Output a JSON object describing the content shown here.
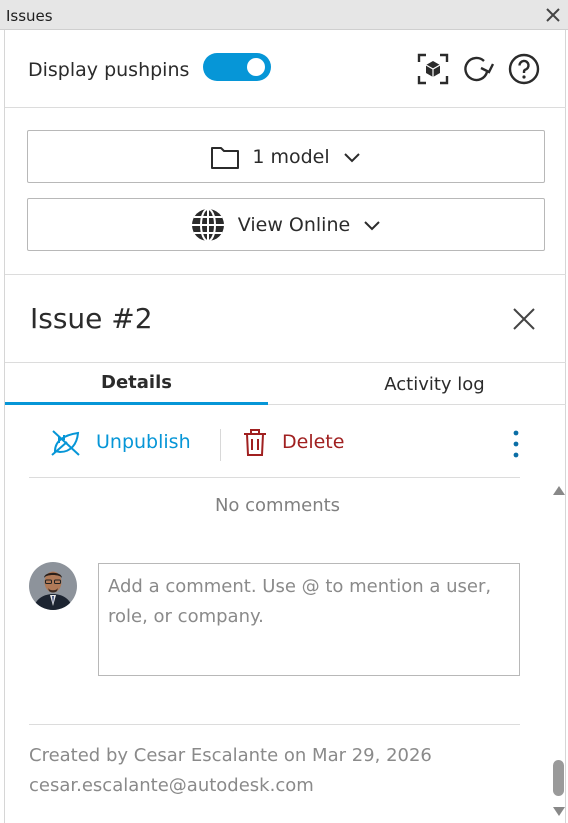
{
  "window": {
    "title": "Issues"
  },
  "toolbar": {
    "pushpins_label": "Display pushpins",
    "pushpins_on": true,
    "icons": [
      "focus-model-icon",
      "refresh-icon",
      "help-icon"
    ]
  },
  "selectors": {
    "model_label": "1 model",
    "view_label": "View Online"
  },
  "issue": {
    "title": "Issue #2"
  },
  "tabs": [
    {
      "label": "Details",
      "active": true
    },
    {
      "label": "Activity log",
      "active": false
    }
  ],
  "actions": {
    "unpublish_label": "Unpublish",
    "delete_label": "Delete"
  },
  "comments": {
    "empty_text": "No comments",
    "placeholder": "Add a comment. Use @ to mention a user, role, or company."
  },
  "meta": {
    "created_line": "Created by Cesar Escalante on Mar 29, 2026",
    "email": "cesar.escalante@autodesk.com"
  },
  "colors": {
    "accent": "#0696d7",
    "danger": "#a02020",
    "muted_text": "#8a8a8a"
  }
}
